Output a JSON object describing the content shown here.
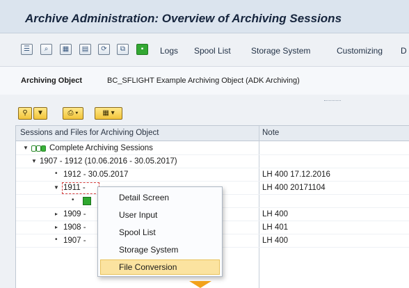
{
  "window": {
    "title": "Archive Administration: Overview of Archiving Sessions"
  },
  "toolbar": {
    "icons": [
      "display-icon",
      "zoom-icon",
      "table-icon",
      "document-icon",
      "refresh-icon",
      "copy-icon",
      "execute-icon"
    ],
    "links": [
      "Logs",
      "Spool List",
      "Storage System",
      "Customizing",
      "D"
    ]
  },
  "archiving_object": {
    "label": "Archiving Object",
    "value": "BC_SFLIGHT Example Archiving Object (ADK Archiving)"
  },
  "alv_toolbar": {
    "buttons": [
      "binoculars-icon",
      "filter-icon",
      "print-icon",
      "export-icon"
    ]
  },
  "grid": {
    "columns": [
      "Sessions and Files for Archiving Object",
      "Note"
    ],
    "rows": [
      {
        "label": "Complete Archiving Sessions",
        "note": ""
      },
      {
        "label": "1907 - 1912 (10.06.2016 - 30.05.2017)",
        "note": ""
      },
      {
        "label": "1912 - 30.05.2017",
        "note": "LH 400  17.12.2016"
      },
      {
        "label": "1911 -",
        "note": "LH 400  20171104"
      },
      {
        "label": "",
        "note": ""
      },
      {
        "label": "1909 -",
        "note": "LH 400"
      },
      {
        "label": "1908 -",
        "note": "LH 401"
      },
      {
        "label": "1907 -",
        "note": "LH 400"
      }
    ]
  },
  "context_menu": {
    "items": [
      "Detail Screen",
      "User Input",
      "Spool List",
      "Storage System",
      "File Conversion"
    ],
    "selected": "File Conversion"
  },
  "colors": {
    "title_bar": "#dbe4ee",
    "selected_menu_item": "#fbe3a0",
    "status_green": "#2fa82f",
    "hint_arrow": "#f2a21b"
  }
}
